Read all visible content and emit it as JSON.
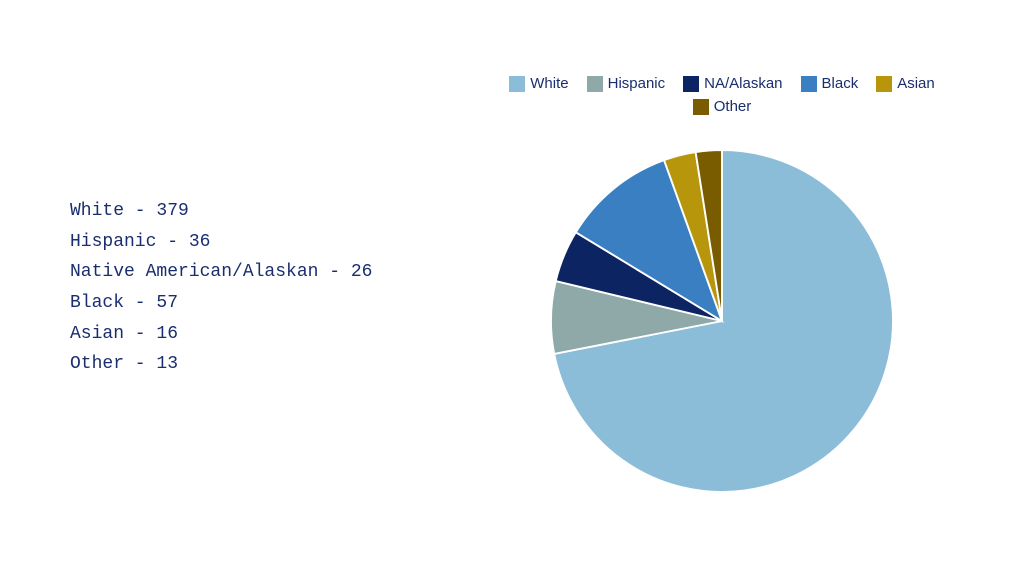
{
  "stats": [
    {
      "label": "White",
      "value": 379,
      "color": "#8bbdd9"
    },
    {
      "label": "Hispanic",
      "value": 36,
      "color": "#8fa8a8"
    },
    {
      "label": "Native American/Alaskan",
      "value": 26,
      "color": "#0d2463"
    },
    {
      "label": "Black",
      "value": 57,
      "color": "#3a7fc1"
    },
    {
      "label": "Asian",
      "value": 16,
      "color": "#b8960c"
    },
    {
      "label": "Other",
      "value": 13,
      "color": "#7a5c00"
    }
  ],
  "list_labels": [
    "White - 379",
    "Hispanic - 36",
    "Native American/Alaskan - 26",
    "Black - 57",
    "Asian - 16",
    "Other - 13"
  ],
  "top_legend": [
    {
      "label": "White",
      "color": "#8bbdd9"
    },
    {
      "label": "Hispanic",
      "color": "#8fa8a8"
    },
    {
      "label": "NA/Alaskan",
      "color": "#0d2463"
    },
    {
      "label": "Black",
      "color": "#3a7fc1"
    },
    {
      "label": "Asian",
      "color": "#b8960c"
    },
    {
      "label": "Other",
      "color": "#7a5c00"
    }
  ]
}
